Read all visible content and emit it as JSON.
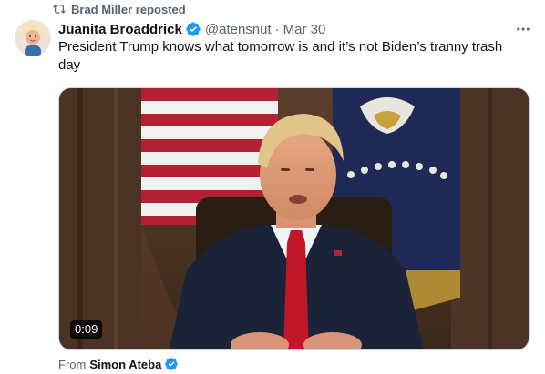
{
  "repost": {
    "label": "Brad Miller reposted",
    "icon": "repost-icon"
  },
  "author": {
    "name": "Juanita Broaddrick",
    "handle": "@atensnut",
    "separator": "·",
    "date": "Mar 30",
    "verified_color": "#1d9bf0"
  },
  "tweet": {
    "text": "President Trump knows what tomorrow is and it’s not Biden’s tranny trash day"
  },
  "media": {
    "duration": "0:09"
  },
  "source": {
    "prefix": "From",
    "name": "Simon Ateba"
  },
  "more_icon": "more-horizontal-icon"
}
